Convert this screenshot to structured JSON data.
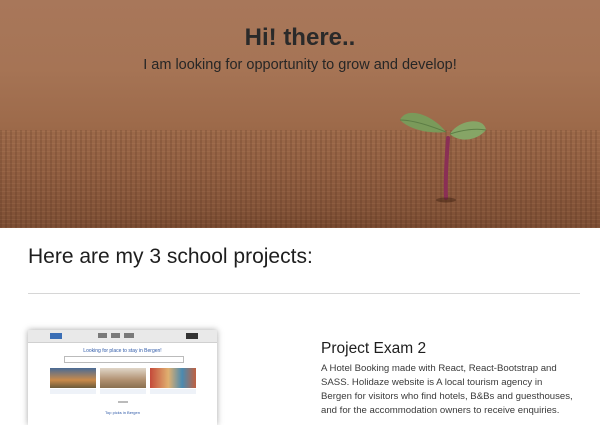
{
  "hero": {
    "title": "Hi! there..",
    "subtitle": "I am looking for opportunity to grow and develop!"
  },
  "projects_section": {
    "heading": "Here are my 3 school projects:",
    "projects": [
      {
        "title": "Project Exam 2",
        "description": "A Hotel Booking made with React, React-Bootstrap and SASS. Holidaze website is A local tourism agency in Bergen for visitors who find hotels, B&Bs and guesthouses, and for the accommodation owners to receive enquiries.",
        "thumbnail": {
          "heading": "Looking for place to stay in Bergen!",
          "subheading": "Top picks in Bergen"
        }
      }
    ]
  },
  "colors": {
    "hero_soil": "#a67455",
    "sprout_leaf": "#7a9a5a",
    "sprout_stem": "#8a2f55"
  }
}
